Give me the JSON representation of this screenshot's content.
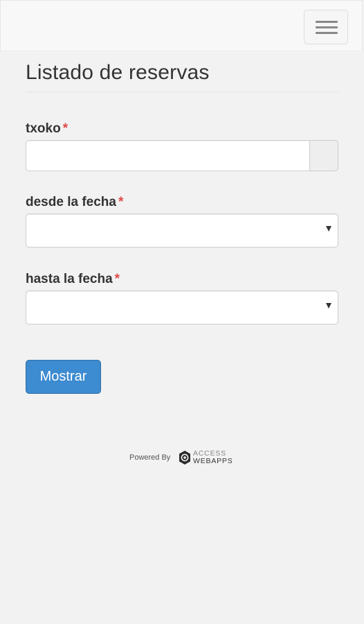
{
  "header": {
    "menu_icon": "hamburger-menu-icon"
  },
  "page": {
    "title": "Listado de reservas"
  },
  "form": {
    "required_marker": "*",
    "txoko": {
      "label": "txoko",
      "value": ""
    },
    "desde": {
      "label": "desde la fecha",
      "selected": ""
    },
    "hasta": {
      "label": "hasta la fecha",
      "selected": ""
    },
    "submit_label": "Mostrar"
  },
  "footer": {
    "powered_by": "Powered By",
    "brand_line1": "ACCESS",
    "brand_line2": "WEBAPPS"
  },
  "colors": {
    "background": "#f2f2f2",
    "primary_button": "#3d8bd0",
    "required": "#e04b4b"
  }
}
